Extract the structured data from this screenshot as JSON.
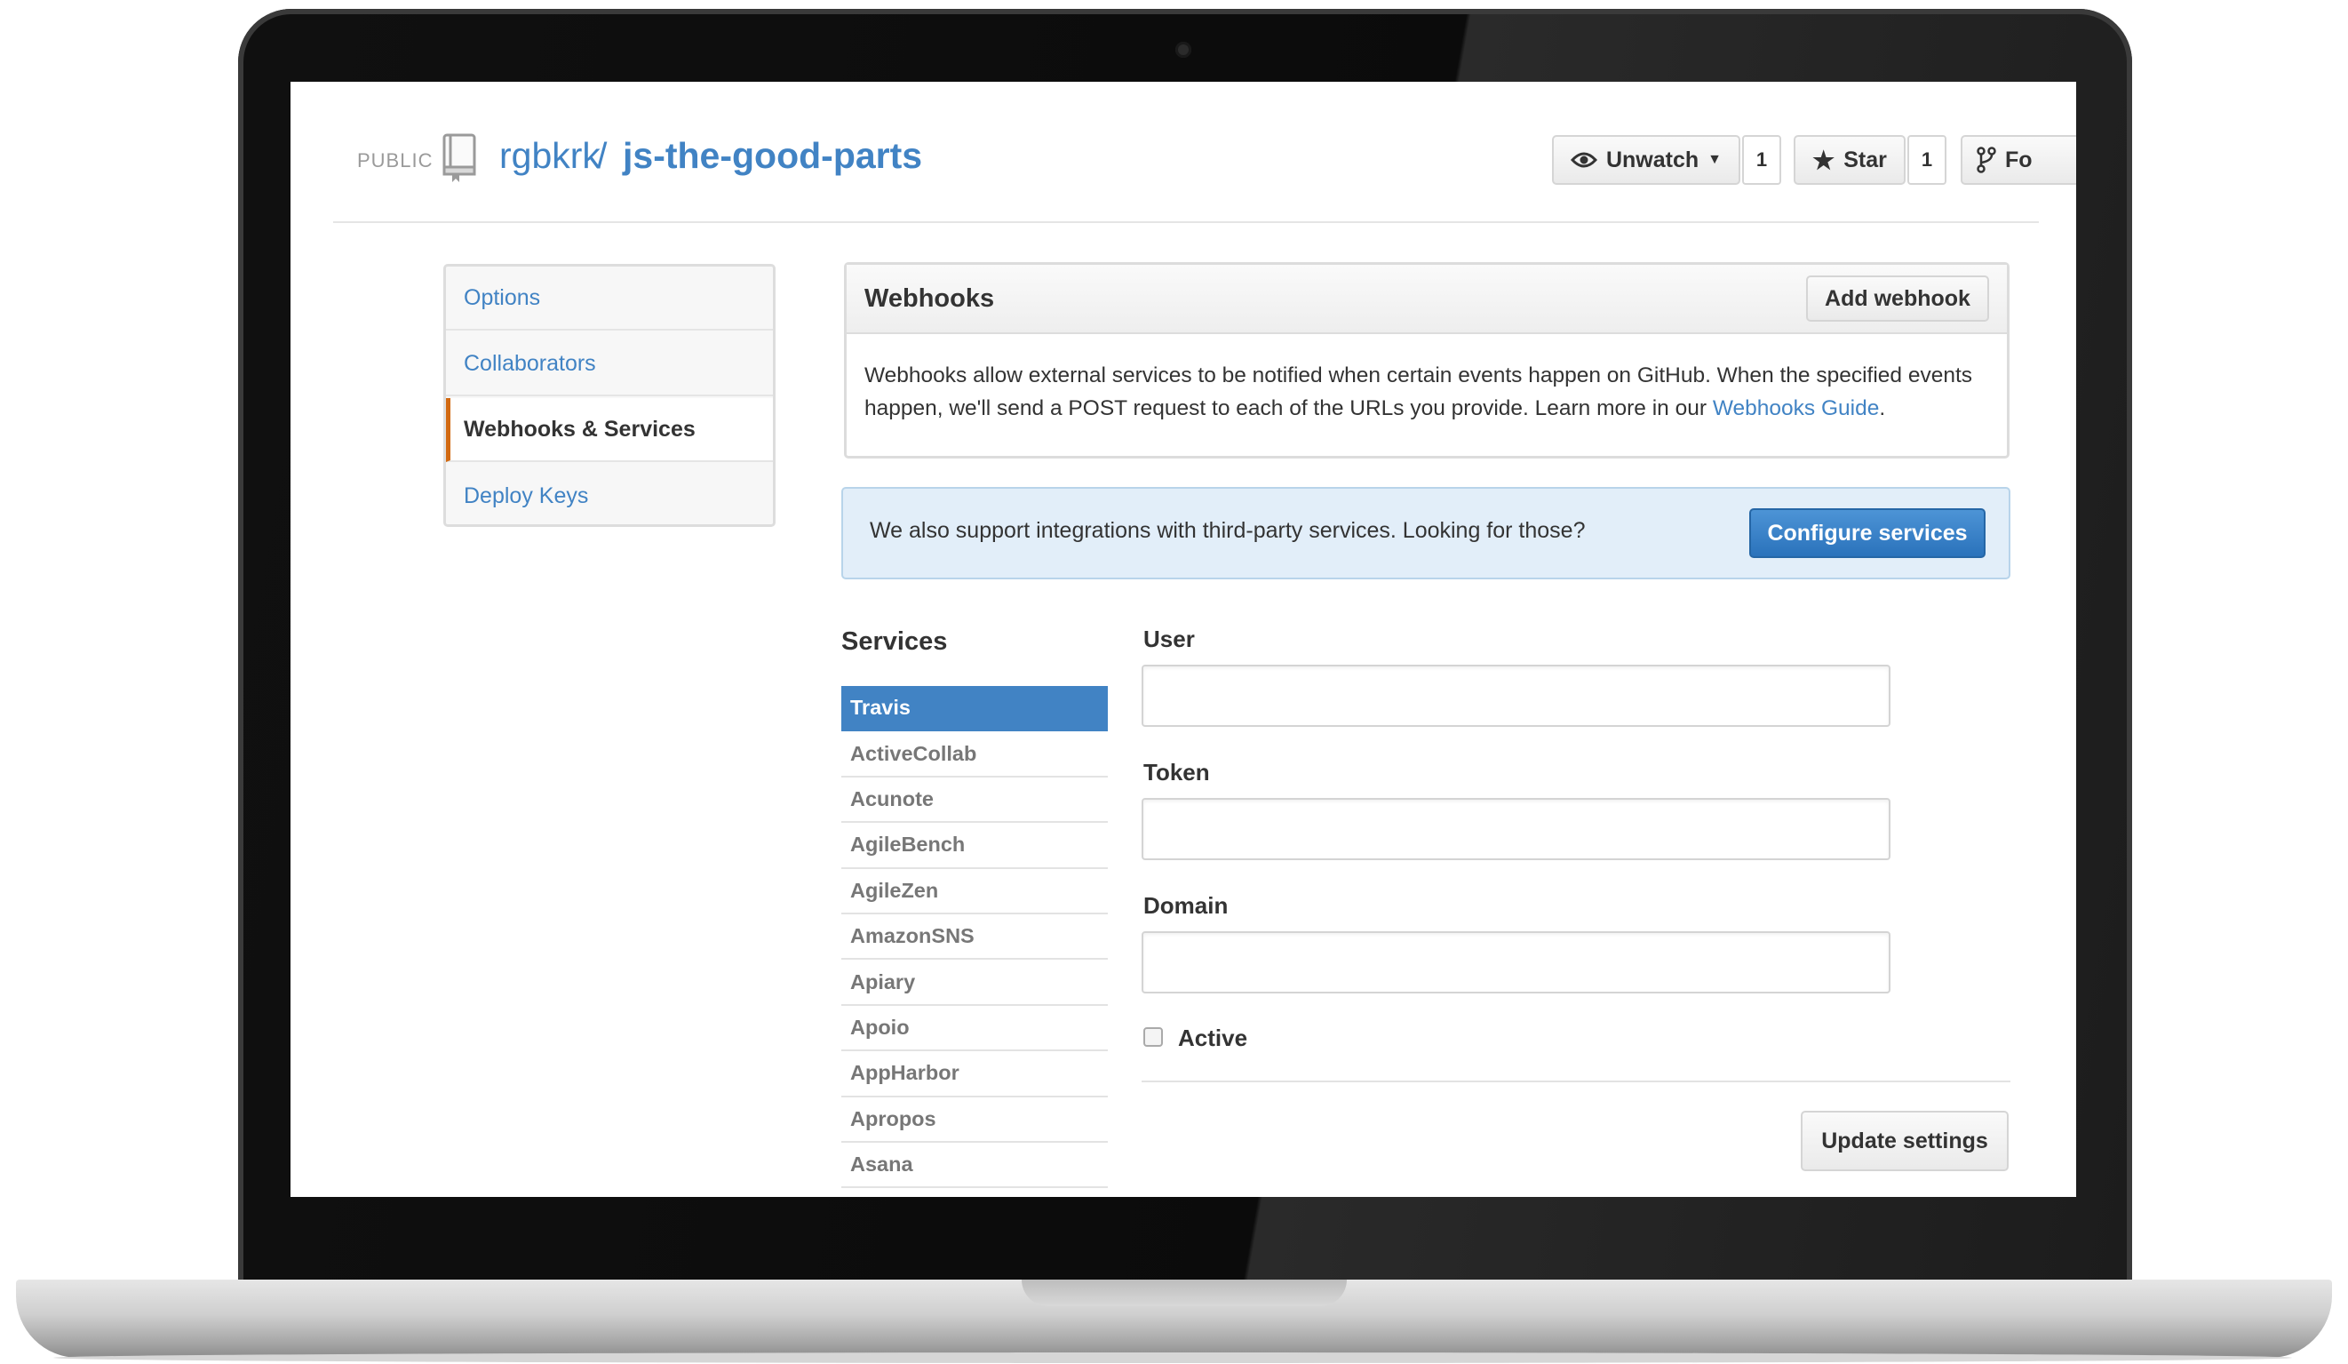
{
  "repo": {
    "visibility": "PUBLIC",
    "owner": "rgbkrk",
    "separator": "/",
    "name": "js-the-good-parts"
  },
  "actions": {
    "unwatch_label": "Unwatch",
    "unwatch_count": "1",
    "star_label": "Star",
    "star_count": "1",
    "fork_label": "Fo"
  },
  "settings_menu": [
    {
      "label": "Options",
      "selected": false
    },
    {
      "label": "Collaborators",
      "selected": false
    },
    {
      "label": "Webhooks & Services",
      "selected": true
    },
    {
      "label": "Deploy Keys",
      "selected": false
    }
  ],
  "webhooks": {
    "title": "Webhooks",
    "add_button": "Add webhook",
    "description": "Webhooks allow external services to be notified when certain events happen on GitHub. When the specified events happen, we'll send a POST request to each of the URLs you provide. Learn more in our ",
    "guide_link": "Webhooks Guide",
    "guide_suffix": "."
  },
  "integrations": {
    "text": "We also support integrations with third-party services. Looking for those?",
    "button": "Configure services"
  },
  "services": {
    "title": "Services",
    "items": [
      "Travis",
      "ActiveCollab",
      "Acunote",
      "AgileBench",
      "AgileZen",
      "AmazonSNS",
      "Apiary",
      "Apoio",
      "AppHarbor",
      "Apropos",
      "Asana"
    ],
    "selected": "Travis"
  },
  "form": {
    "user_label": "User",
    "user_value": "",
    "token_label": "Token",
    "token_value": "",
    "domain_label": "Domain",
    "domain_value": "",
    "active_label": "Active",
    "active_checked": false,
    "submit_label": "Update settings"
  },
  "colors": {
    "link": "#4183c4",
    "selected_accent": "#d26911",
    "primary_button": "#2a72bb",
    "banner_bg": "#e2eef9"
  }
}
